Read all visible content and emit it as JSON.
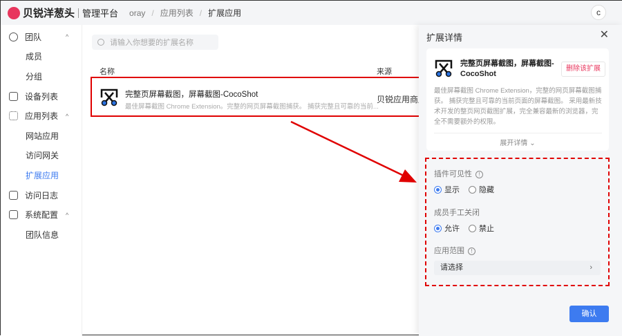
{
  "header": {
    "brand": "贝锐洋葱头",
    "platform": "管理平台",
    "breadcrumb": [
      "oray",
      "应用列表",
      "扩展应用"
    ],
    "avatar": "c"
  },
  "sidebar": {
    "items": [
      {
        "label": "团队",
        "icon": "team-icon",
        "expanded": true
      },
      {
        "label": "成员",
        "sub": true
      },
      {
        "label": "分组",
        "sub": true
      },
      {
        "label": "设备列表",
        "icon": "device-icon"
      },
      {
        "label": "应用列表",
        "icon": "apps-icon",
        "expanded": true
      },
      {
        "label": "网站应用",
        "sub": true
      },
      {
        "label": "访问网关",
        "sub": true
      },
      {
        "label": "扩展应用",
        "sub": true,
        "active": true
      },
      {
        "label": "访问日志",
        "icon": "log-icon"
      },
      {
        "label": "系统配置",
        "icon": "settings-icon",
        "expanded": true
      },
      {
        "label": "团队信息",
        "sub": true
      }
    ]
  },
  "main": {
    "search_placeholder": "请输入你想要的扩展名称",
    "columns": [
      "名称",
      "来源"
    ],
    "row": {
      "title": "完整页屏幕截图，屏幕截图-CocoShot",
      "desc": "最佳屏幕截图 Chrome Extension。完整的网页屏幕截图捕获。 捕获完整且可靠的当前...",
      "source": "贝锐应用商店"
    }
  },
  "drawer": {
    "title": "扩展详情",
    "card": {
      "title": "完整页屏幕截图，屏幕截图-CocoShot",
      "delete": "删除该扩展",
      "desc": "最佳屏幕截图 Chrome Extension，完整的网页屏幕截图捕获。 捕获完整且可靠的当前页面的屏幕截图。 采用最新技术开发的整页网页截图扩展，完全兼容最新的浏览器，完全不需要额外的权限。",
      "expand": "展开详情"
    },
    "visibility": {
      "label": "插件可见性",
      "options": [
        "显示",
        "隐藏"
      ],
      "selected": "显示"
    },
    "manual_close": {
      "label": "成员手工关闭",
      "options": [
        "允许",
        "禁止"
      ],
      "selected": "允许"
    },
    "scope": {
      "label": "应用范围",
      "placeholder": "请选择"
    },
    "confirm": "确认"
  },
  "colors": {
    "accent": "#3d7bf0",
    "annotation": "#e00000",
    "brand": "#e8365d"
  }
}
